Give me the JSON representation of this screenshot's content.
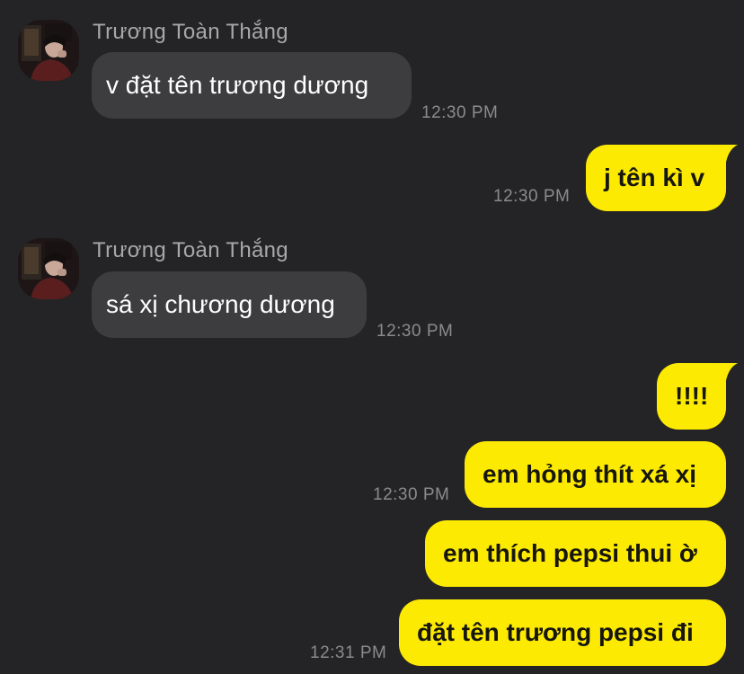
{
  "conversation": {
    "messages": [
      {
        "side": "in",
        "sender": "Trương Toàn Thắng",
        "text": "v đặt tên trương dương",
        "time": "12:30 PM"
      },
      {
        "side": "out",
        "text": "j tên kì v",
        "time": "12:30 PM"
      },
      {
        "side": "in",
        "sender": "Trương Toàn Thắng",
        "text": "sá xị chương dương",
        "time": "12:30 PM"
      },
      {
        "side": "out",
        "text": "!!!!"
      },
      {
        "side": "out",
        "text": "em hỏng thít xá xị",
        "time": "12:30 PM"
      },
      {
        "side": "out",
        "text": "em thích pepsi thui ờ"
      },
      {
        "side": "out",
        "text": "đặt tên trương pepsi đi",
        "time": "12:31 PM"
      }
    ]
  },
  "colors": {
    "background": "#242426",
    "incoming_bubble": "#3d3d3f",
    "outgoing_bubble": "#fdea03",
    "timestamp": "#8b8b8e",
    "sender_name": "#a8a8ab"
  },
  "icons": {
    "avatar": "profile-photo"
  }
}
